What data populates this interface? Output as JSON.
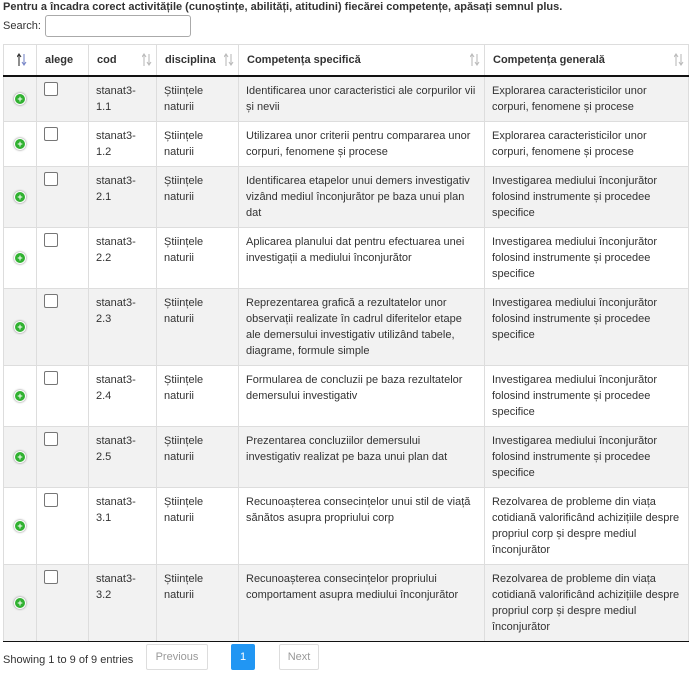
{
  "instruction": "Pentru a încadra corect activitățile (cunoștințe, abilități, atitudini) fiecărei competențe, apăsați semnul plus.",
  "search": {
    "label": "Search:",
    "value": "",
    "placeholder": ""
  },
  "table": {
    "headers": {
      "col0": "",
      "alege": "alege",
      "cod": "cod",
      "disciplina": "disciplina",
      "competenta_specifica": "Competența specifică",
      "competenta_generala": "Competența generală"
    },
    "rows": [
      {
        "cod": "stanat3-1.1",
        "disciplina": "Științele naturii",
        "specifica": "Identificarea unor caracteristici ale corpurilor vii și nevii",
        "generala": "Explorarea caracteristicilor unor corpuri, fenomene și procese"
      },
      {
        "cod": "stanat3-1.2",
        "disciplina": "Științele naturii",
        "specifica": "Utilizarea unor criterii pentru compararea unor corpuri, fenomene și procese",
        "generala": "Explorarea caracteristicilor unor corpuri, fenomene și procese"
      },
      {
        "cod": "stanat3-2.1",
        "disciplina": "Științele naturii",
        "specifica": "Identificarea etapelor unui demers investigativ vizând mediul înconjurător pe baza unui plan dat",
        "generala": "Investigarea mediului înconjurător folosind instrumente și procedee specifice"
      },
      {
        "cod": "stanat3-2.2",
        "disciplina": "Științele naturii",
        "specifica": "Aplicarea planului dat pentru efectuarea unei investigații a mediului înconjurător",
        "generala": "Investigarea mediului înconjurător folosind instrumente și procedee specifice"
      },
      {
        "cod": "stanat3-2.3",
        "disciplina": "Științele naturii",
        "specifica": "Reprezentarea grafică a rezultatelor unor observații realizate în cadrul diferitelor etape ale demersului investigativ utilizând tabele, diagrame, formule simple",
        "generala": "Investigarea mediului înconjurător folosind instrumente și procedee specifice"
      },
      {
        "cod": "stanat3-2.4",
        "disciplina": "Științele naturii",
        "specifica": "Formularea de concluzii pe baza rezultatelor demersului investigativ",
        "generala": "Investigarea mediului înconjurător folosind instrumente și procedee specifice"
      },
      {
        "cod": "stanat3-2.5",
        "disciplina": "Științele naturii",
        "specifica": "Prezentarea concluziilor demersului investigativ realizat pe baza unui plan dat",
        "generala": "Investigarea mediului înconjurător folosind instrumente și procedee specifice"
      },
      {
        "cod": "stanat3-3.1",
        "disciplina": "Științele naturii",
        "specifica": "Recunoașterea consecințelor unui stil de viață sănătos asupra propriului corp",
        "generala": "Rezolvarea de probleme din viața cotidiană valorificând achizițiile despre propriul corp și despre mediul înconjurător"
      },
      {
        "cod": "stanat3-3.2",
        "disciplina": "Științele naturii",
        "specifica": "Recunoașterea consecințelor propriului comportament asupra mediului înconjurător",
        "generala": "Rezolvarea de probleme din viața cotidiană valorificând achizițiile despre propriul corp și despre mediul înconjurător"
      }
    ]
  },
  "footer": {
    "info": "Showing 1 to 9 of 9 entries",
    "previous": "Previous",
    "page": "1",
    "next": "Next"
  },
  "colors": {
    "accent": "#2196f3",
    "plus_icon": "#31b131",
    "stripe": "#f2f2f2",
    "border": "#dddddd"
  },
  "icons": {
    "expand": "plus-circle-icon",
    "sort": "sort-arrows-icon"
  }
}
